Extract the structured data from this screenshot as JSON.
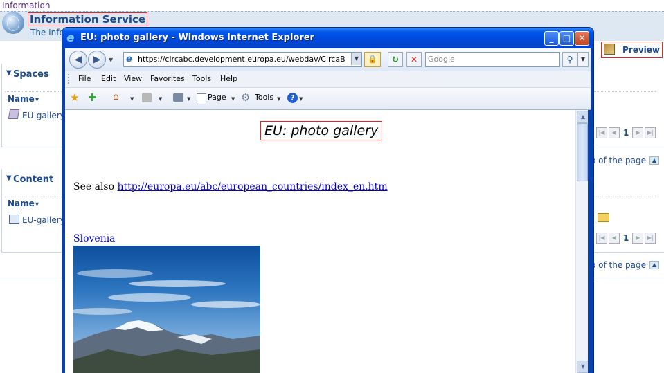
{
  "app": {
    "breadcrumb": "Information",
    "service_title": "Information Service",
    "service_subtitle": "The Info",
    "preview_label": "Preview"
  },
  "spaces_panel": {
    "title": "Spaces",
    "column_name": "Name",
    "item": "EU-gallery",
    "page_number": "1",
    "top_of_page": "o of the page"
  },
  "content_panel": {
    "title": "Content",
    "column_name": "Name",
    "item": "EU-gallery",
    "page_number": "1",
    "top_of_page": "o of the page"
  },
  "browser": {
    "title": "EU: photo gallery - Windows Internet Explorer",
    "address": "https://circabc.development.europa.eu/webdav/CircaBC/Categ",
    "search_placeholder": "Google",
    "menu": [
      "File",
      "Edit",
      "View",
      "Favorites",
      "Tools",
      "Help"
    ],
    "toolbar": {
      "page_label": "Page",
      "tools_label": "Tools"
    },
    "window_buttons": {
      "minimize": "_",
      "maximize": "□",
      "close": "✕"
    }
  },
  "page": {
    "title": "EU: photo gallery",
    "see_also_prefix": "See also",
    "see_also_link": "http://europa.eu/abc/european_countries/index_en.htm",
    "country": "Slovenia"
  }
}
